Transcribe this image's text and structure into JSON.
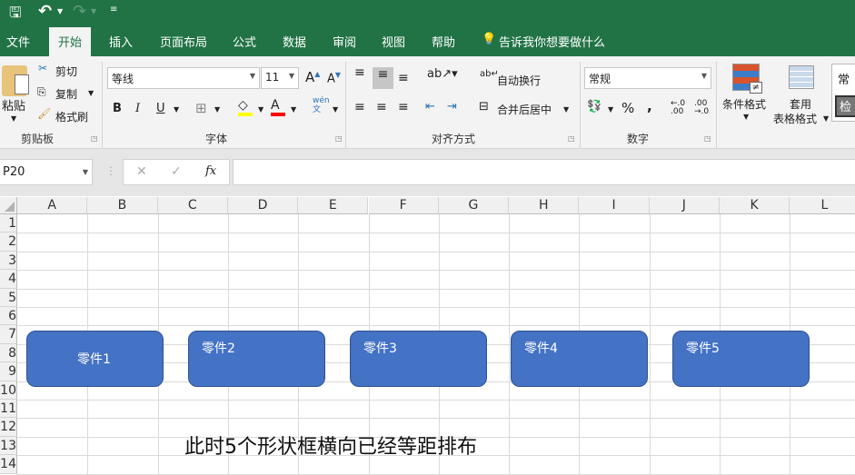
{
  "qat": {
    "save": "save-icon",
    "undo": "undo-icon",
    "redo": "redo-icon",
    "customize": "customize-icon"
  },
  "tabs": [
    "文件",
    "开始",
    "插入",
    "页面布局",
    "公式",
    "数据",
    "审阅",
    "视图",
    "帮助"
  ],
  "tell_me": "告诉我你想要做什么",
  "clipboard": {
    "paste": "粘贴",
    "cut": "剪切",
    "copy": "复制",
    "format_painter": "格式刷",
    "group": "剪贴板"
  },
  "font": {
    "name": "等线",
    "size": "11",
    "bold": "B",
    "italic": "I",
    "underline": "U",
    "group": "字体",
    "phonetic": "wén\n文",
    "highlight_color": "#ffff00",
    "font_color": "#ff0000"
  },
  "alignment": {
    "wrap": "自动换行",
    "merge": "合并后居中",
    "group": "对齐方式"
  },
  "number": {
    "format": "常规",
    "percent": "%",
    "comma": ",",
    "group": "数字"
  },
  "styles": {
    "conditional": "条件格式",
    "table1": "套用",
    "table2": "表格格式",
    "style1": "常",
    "style2": "检"
  },
  "formula_bar": {
    "name_box": "P20",
    "cancel": "✕",
    "enter": "✓",
    "fx": "fx",
    "value": ""
  },
  "columns": [
    "A",
    "B",
    "C",
    "D",
    "E",
    "F",
    "G",
    "H",
    "I",
    "J",
    "K",
    "L"
  ],
  "rows": [
    "1",
    "2",
    "3",
    "4",
    "5",
    "6",
    "7",
    "8",
    "9",
    "10",
    "11",
    "12",
    "13",
    "14"
  ],
  "shapes": [
    {
      "label": "零件1"
    },
    {
      "label": "零件2"
    },
    {
      "label": "零件3"
    },
    {
      "label": "零件4"
    },
    {
      "label": "零件5"
    }
  ],
  "caption": "此时5个形状框横向已经等距排布",
  "colors": {
    "excel_green": "#217346",
    "shape_fill": "#4472c4"
  }
}
